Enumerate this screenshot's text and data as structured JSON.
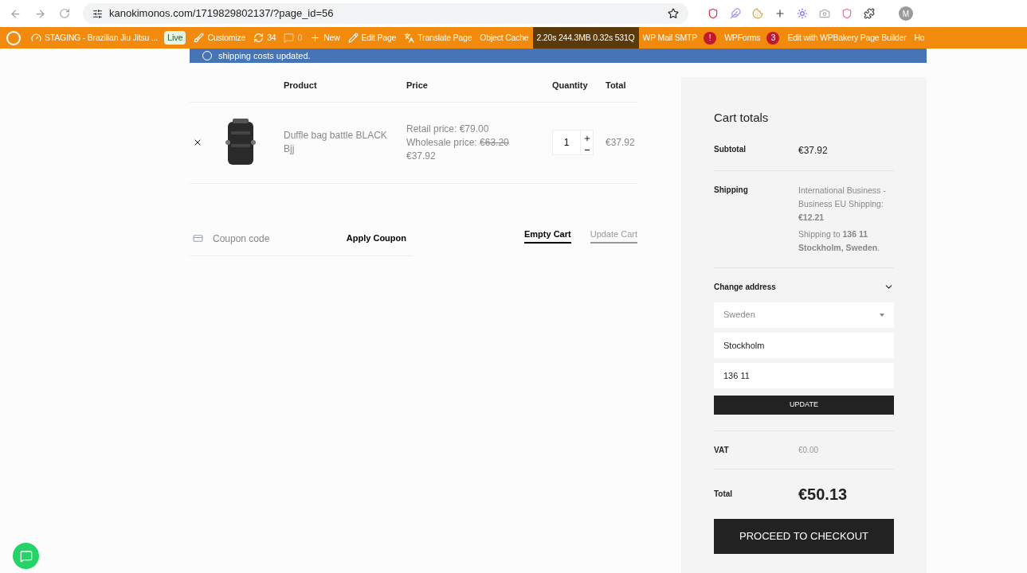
{
  "browser": {
    "url": "kanokimonos.com/1719829802137/?page_id=56",
    "profile_initial": "M"
  },
  "admin_bar": {
    "items": [
      {
        "kind": "site",
        "label": "STAGING - Brazilian Jiu Jitsu ...",
        "badge": "Live"
      },
      {
        "kind": "customize",
        "label": "Customize"
      },
      {
        "kind": "updates",
        "label": "34"
      },
      {
        "kind": "comments",
        "label": "0"
      },
      {
        "kind": "new",
        "label": "New"
      },
      {
        "kind": "edit",
        "label": "Edit Page"
      },
      {
        "kind": "translate",
        "label": "Translate Page"
      },
      {
        "kind": "plain",
        "label": "Object Cache"
      },
      {
        "kind": "stats",
        "label": "2.20s  244.3MB  0.32s  531Q"
      },
      {
        "kind": "alert",
        "label": "WP Mail SMTP",
        "count": "!"
      },
      {
        "kind": "alert",
        "label": "WPForms",
        "count": "3"
      },
      {
        "kind": "plain",
        "label": "Edit with WPBakery Page Builder"
      },
      {
        "kind": "plain",
        "label": "Ho"
      }
    ]
  },
  "notice": "shipping costs updated.",
  "cart": {
    "columns": [
      "Product",
      "Price",
      "Quantity",
      "Total"
    ],
    "rows": [
      {
        "product": "Duffle bag battle BLACK Bjj",
        "retail": "Retail price: €79.00",
        "wholesale_label": "Wholesale price:",
        "wholesale_old": "€63.20",
        "price": "€37.92",
        "quantity": "1",
        "total": "€37.92"
      }
    ],
    "coupon_placeholder": "Coupon code",
    "apply": "Apply Coupon",
    "empty": "Empty Cart",
    "update": "Update Cart"
  },
  "totals": {
    "title": "Cart totals",
    "subtotal_label": "Subtotal",
    "subtotal": "€37.92",
    "shipping_label": "Shipping",
    "shipping_method": "International Business - Business EU Shipping:",
    "shipping_cost": "€12.21",
    "shipping_to": "Shipping to **136 11 Stockholm, Sweden**.",
    "change_address": "Change address",
    "expanded": true,
    "country": "Sweden",
    "city": "Stockholm",
    "postcode": "136 11",
    "update": "UPDATE",
    "vat_label": "VAT",
    "vat": "€0.00",
    "total_label": "Total",
    "total": "€50.13",
    "checkout": "PROCEED TO CHECKOUT"
  }
}
